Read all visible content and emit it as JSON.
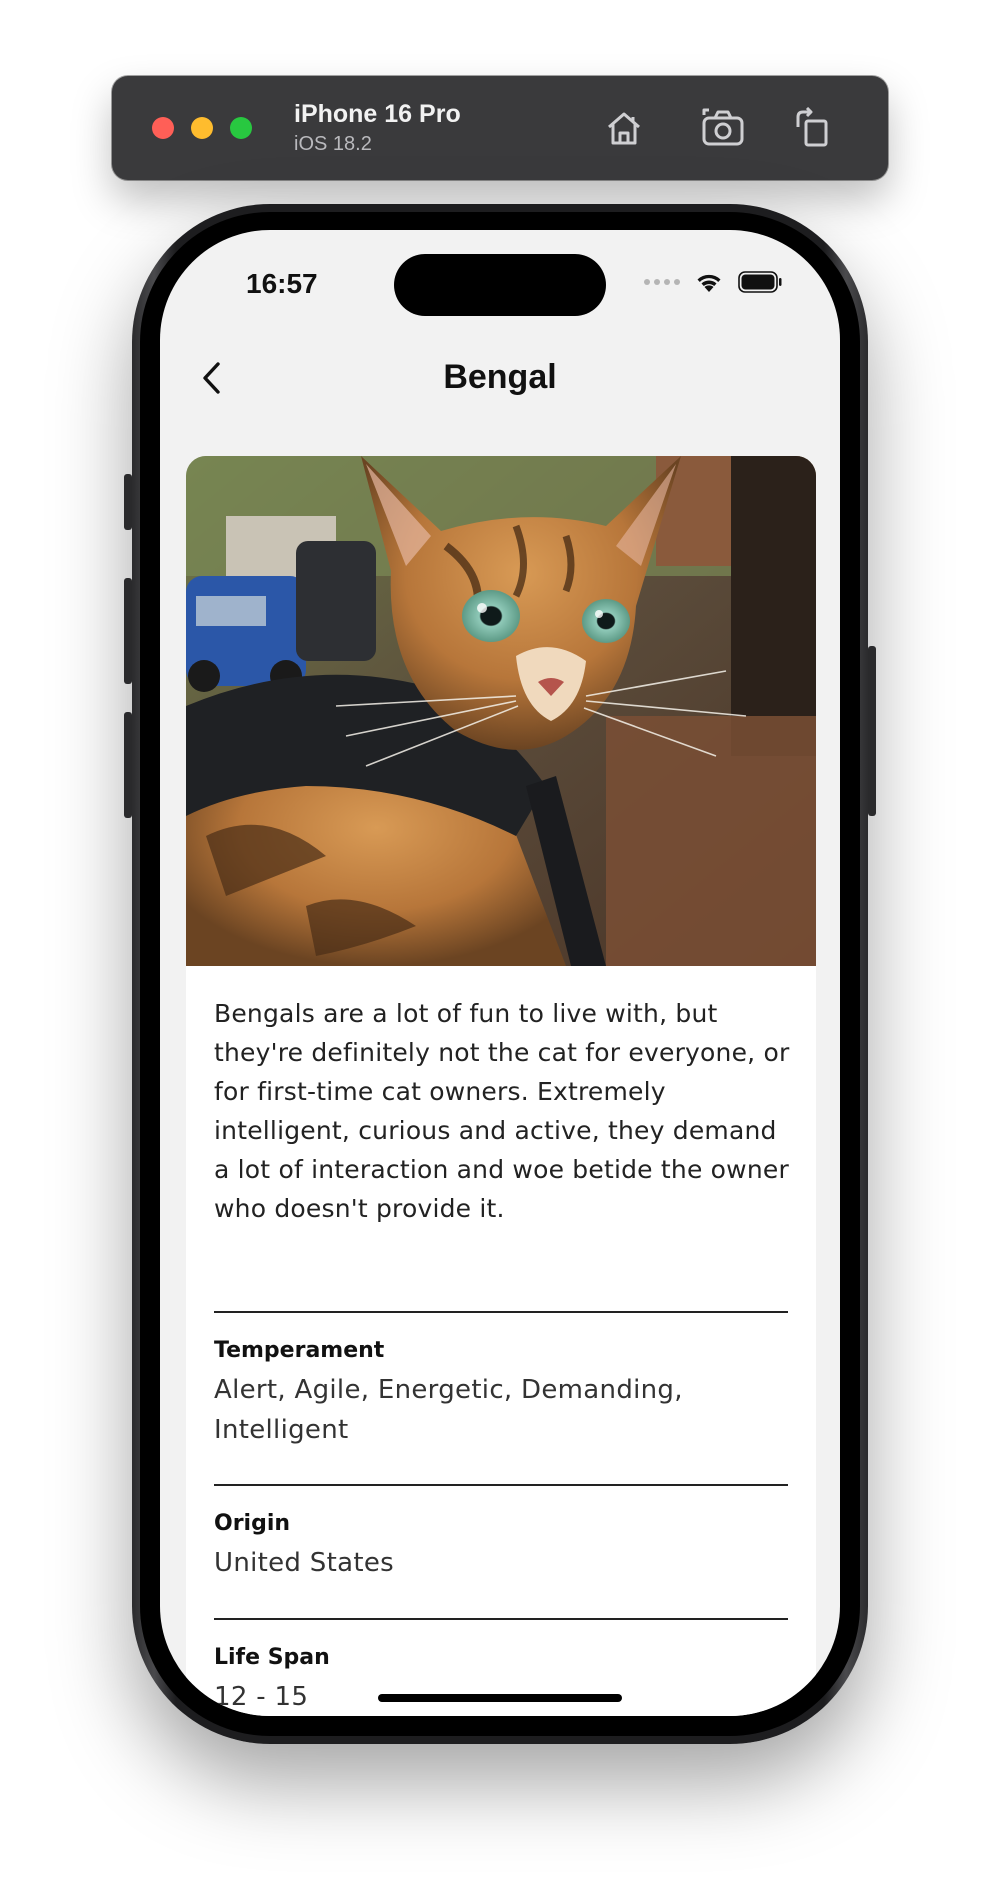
{
  "simulator": {
    "device_name": "iPhone 16 Pro",
    "os_version": "iOS 18.2",
    "icons": [
      "home-icon",
      "screenshot-icon",
      "rotate-icon"
    ]
  },
  "status_bar": {
    "time": "16:57",
    "icons": [
      "cellular-dots-icon",
      "wifi-icon",
      "battery-icon"
    ]
  },
  "nav": {
    "title": "Bengal",
    "back_icon": "chevron-left-icon"
  },
  "breed": {
    "image": "bengal-cat-photo",
    "description": "Bengals are a lot of fun to live with, but they're definitely not the cat for everyone, or for first-time cat owners. Extremely intelligent, curious and active, they demand a lot of interaction and woe betide the owner who doesn't provide it.",
    "attributes": [
      {
        "label": "Temperament",
        "value": "Alert, Agile, Energetic, Demanding, Intelligent"
      },
      {
        "label": "Origin",
        "value": "United States"
      },
      {
        "label": "Life Span",
        "value": "12 - 15"
      }
    ]
  },
  "colors": {
    "screen_background": "#f2f2f2",
    "card_background": "#ffffff",
    "text_primary": "#111111",
    "toolbar_background": "#3a3a3c",
    "traffic_red": "#ff5f57",
    "traffic_yellow": "#febc2e",
    "traffic_green": "#28c840"
  }
}
